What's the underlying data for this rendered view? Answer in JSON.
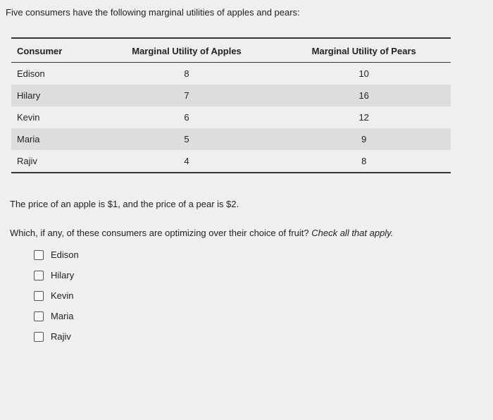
{
  "intro": "Five consumers have the following marginal utilities of apples and pears:",
  "table": {
    "headers": {
      "consumer": "Consumer",
      "apples": "Marginal Utility of Apples",
      "pears": "Marginal Utility of Pears"
    },
    "rows": [
      {
        "consumer": "Edison",
        "apples": "8",
        "pears": "10"
      },
      {
        "consumer": "Hilary",
        "apples": "7",
        "pears": "16"
      },
      {
        "consumer": "Kevin",
        "apples": "6",
        "pears": "12"
      },
      {
        "consumer": "Maria",
        "apples": "5",
        "pears": "9"
      },
      {
        "consumer": "Rajiv",
        "apples": "4",
        "pears": "8"
      }
    ]
  },
  "price_text": "The price of an apple is $1, and the price of a pear is $2.",
  "question": {
    "prefix": "Which, if any, of these consumers are optimizing over their choice of fruit? ",
    "suffix": "Check all that apply."
  },
  "options": [
    {
      "label": "Edison"
    },
    {
      "label": "Hilary"
    },
    {
      "label": "Kevin"
    },
    {
      "label": "Maria"
    },
    {
      "label": "Rajiv"
    }
  ]
}
